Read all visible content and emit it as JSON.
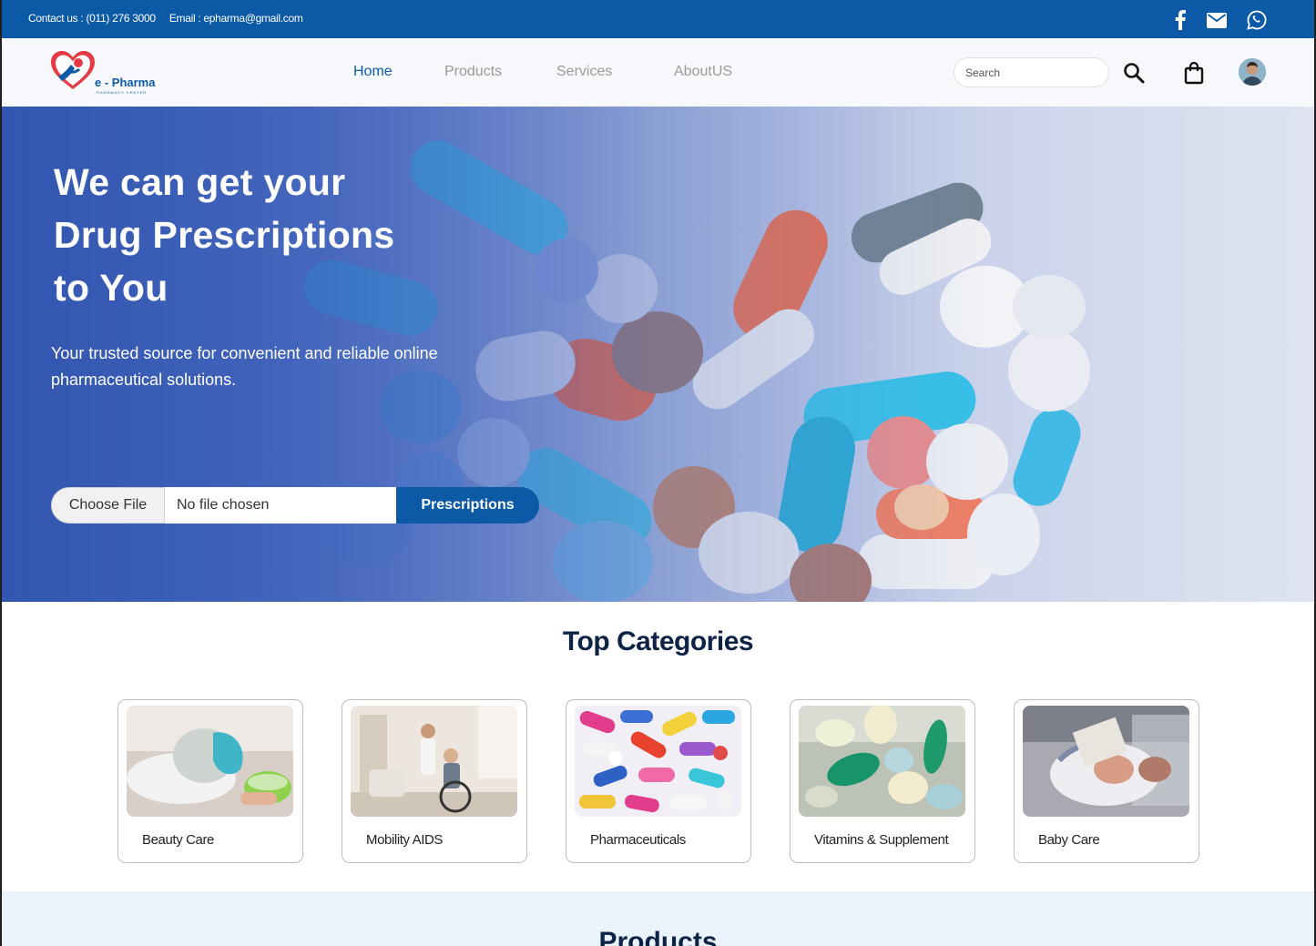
{
  "topbar": {
    "contact": "Contact us : (011) 276 3000",
    "email": "Email : epharma@gmail.com",
    "social_icons": [
      "facebook-icon",
      "mail-icon",
      "whatsapp-icon"
    ]
  },
  "brand": {
    "name": "e - Pharma",
    "tagline": "PHARMACY CENTER",
    "primary_color": "#0c5aa6",
    "accent_color": "#e53945"
  },
  "nav": {
    "links": [
      "Home",
      "Products",
      "Services",
      "AboutUS"
    ],
    "active": "Home"
  },
  "search": {
    "placeholder": "Search"
  },
  "hero": {
    "title_line1": "We can get your",
    "title_line2": "Drug Prescriptions",
    "title_line3": "to You",
    "subtitle": "Your trusted source for convenient and reliable online pharmaceutical solutions.",
    "choose_file_label": "Choose File",
    "file_status": "No file chosen",
    "submit_label": "Prescriptions"
  },
  "categories": {
    "title": "Top Categories",
    "items": [
      {
        "label": "Beauty Care"
      },
      {
        "label": "Mobility AIDS"
      },
      {
        "label": "Pharmaceuticals"
      },
      {
        "label": "Vitamins & Supplement"
      },
      {
        "label": "Baby Care"
      }
    ]
  },
  "products": {
    "title": "Products"
  }
}
